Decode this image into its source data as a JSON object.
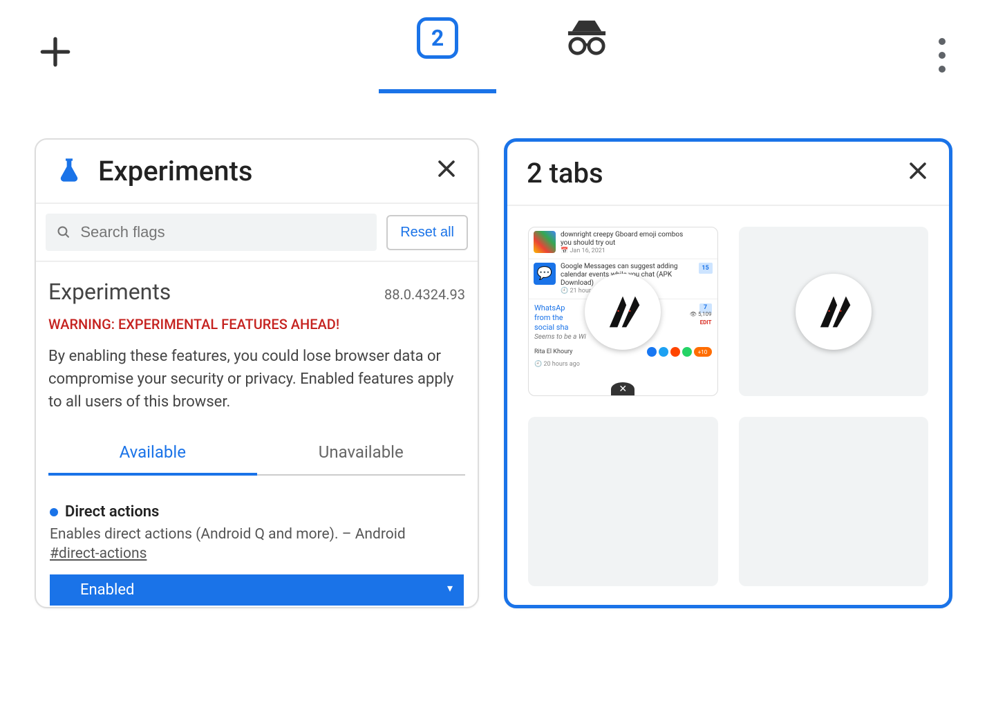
{
  "header": {
    "tab_count": "2"
  },
  "card_left": {
    "title": "Experiments",
    "search_placeholder": "Search flags",
    "reset_label": "Reset all",
    "section_heading": "Experiments",
    "version": "88.0.4324.93",
    "warning": "WARNING: EXPERIMENTAL FEATURES AHEAD!",
    "description": "By enabling these features, you could lose browser data or compromise your security or privacy. Enabled features apply to all users of this browser.",
    "tabs": {
      "available": "Available",
      "unavailable": "Unavailable"
    },
    "flag": {
      "name": "Direct actions",
      "desc": "Enables direct actions (Android Q and more). – Android",
      "link": "#direct-actions",
      "state": "Enabled"
    }
  },
  "card_right": {
    "title": "2 tabs",
    "articles": {
      "a1": {
        "title": "downright creepy Gboard emoji combos you should try out",
        "date": "Jan 16, 2021"
      },
      "a2": {
        "title": "Google Messages can suggest adding calendar events while you chat (APK Download)",
        "date": "21 hour",
        "count": "15"
      },
      "a3": {
        "title_line1": "WhatsAp",
        "title_line2": "from the",
        "title_line3": "social sha",
        "sub": "Seems to be a Wi",
        "count": "7",
        "views": "5,109",
        "edit": "EDIT"
      },
      "author": "Rita El Khoury",
      "author_date": "20 hours ago",
      "share_more": "+10"
    }
  }
}
